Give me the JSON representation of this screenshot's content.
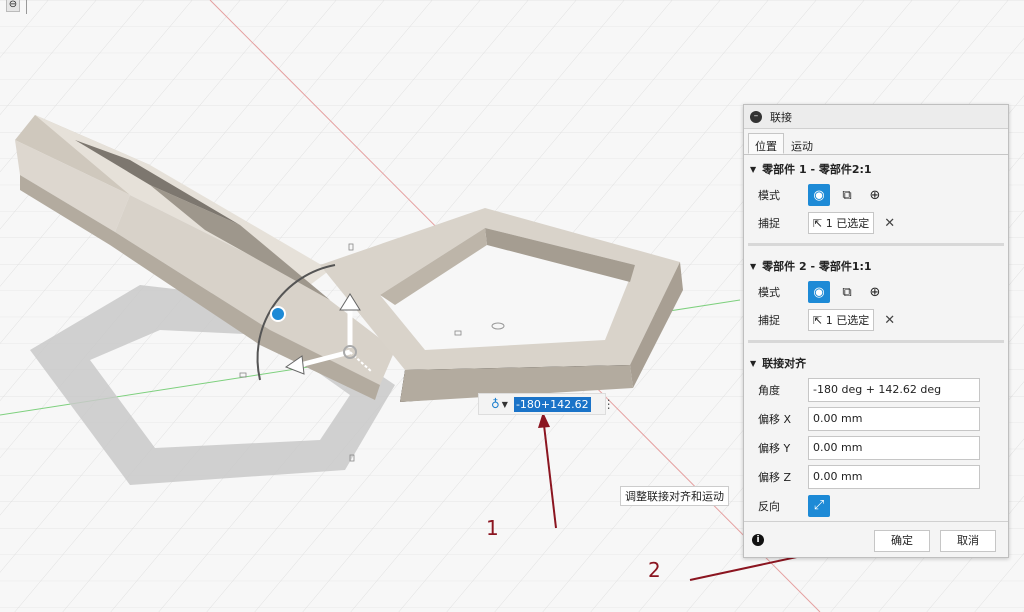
{
  "canvas": {
    "value_input": "-180+142.62",
    "hint_tooltip": "调整联接对齐和运动",
    "small_labels": [
      "0",
      "0",
      "0"
    ]
  },
  "annotations": {
    "label1": "1",
    "label2": "2"
  },
  "dialog": {
    "title": "联接",
    "tabs": [
      {
        "label": "位置",
        "active": true
      },
      {
        "label": "运动",
        "active": false
      }
    ],
    "component1": {
      "header": "零部件 1 - 零部件2:1",
      "mode_label": "模式",
      "snap_label": "捕捉",
      "snap_value": "1 已选定"
    },
    "component2": {
      "header": "零部件 2 - 零部件1:1",
      "mode_label": "模式",
      "snap_label": "捕捉",
      "snap_value": "1 已选定"
    },
    "alignment": {
      "header": "联接对齐",
      "angle_label": "角度",
      "angle_value": "-180 deg + 142.62 deg",
      "offset_x_label": "偏移 X",
      "offset_x_value": "0.00 mm",
      "offset_y_label": "偏移 Y",
      "offset_y_value": "0.00 mm",
      "offset_z_label": "偏移 Z",
      "offset_z_value": "0.00 mm",
      "flip_label": "反向"
    },
    "ok_label": "确定",
    "cancel_label": "取消"
  },
  "colors": {
    "accent": "#1d8ad6",
    "annotation": "#8b1520",
    "model_top": "#ddd7cf",
    "model_side": "#aaa297"
  }
}
